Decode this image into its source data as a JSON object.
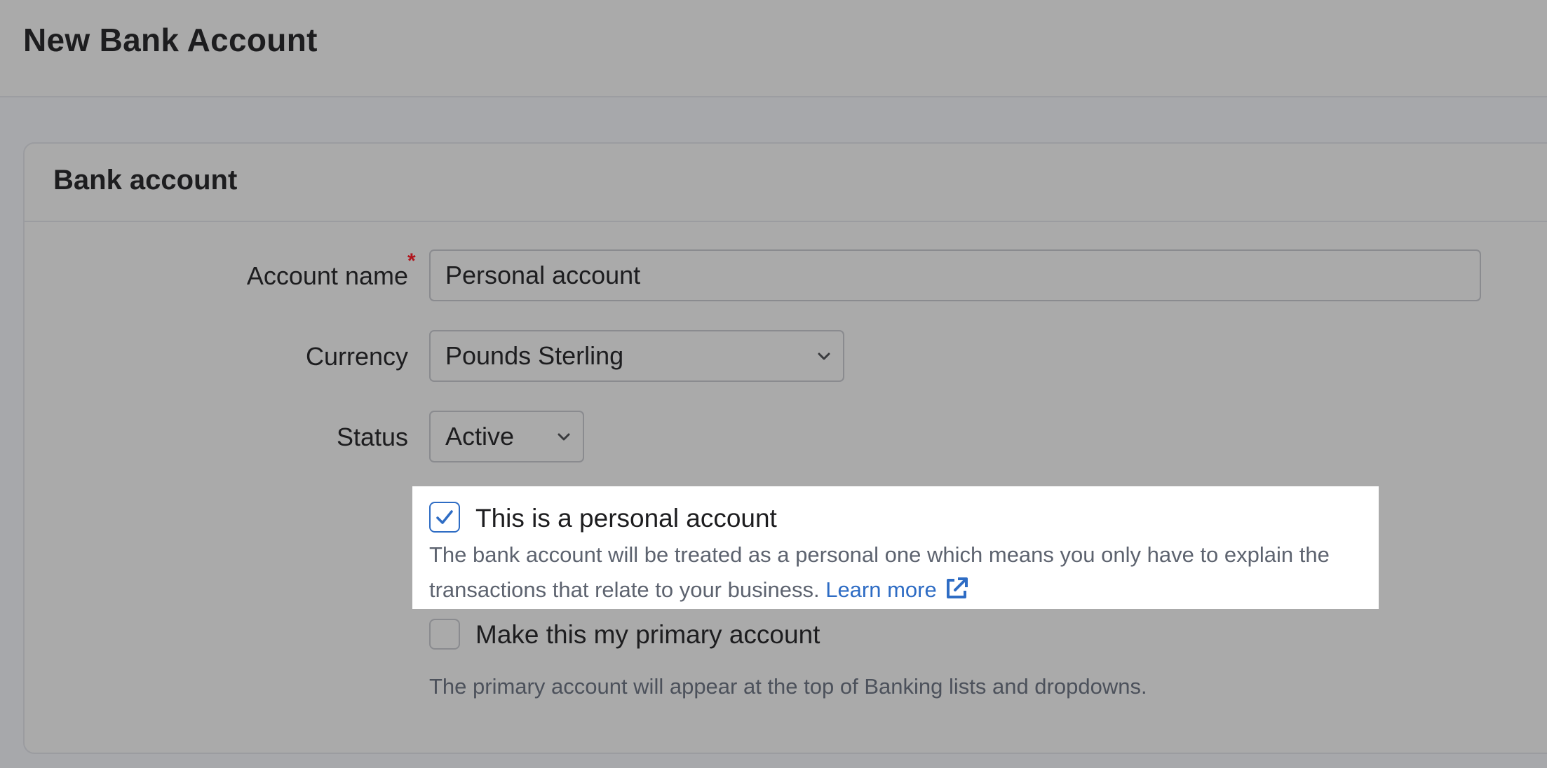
{
  "page": {
    "title": "New Bank Account"
  },
  "card": {
    "title": "Bank account"
  },
  "form": {
    "account_name": {
      "label": "Account name",
      "required_mark": "*",
      "value": "Personal account"
    },
    "currency": {
      "label": "Currency",
      "value": "Pounds Sterling"
    },
    "status": {
      "label": "Status",
      "value": "Active"
    },
    "personal": {
      "checked": true,
      "label": "This is a personal account",
      "help_text": "The bank account will be treated as a personal one which means you only have to explain the transactions that relate to your business.",
      "link_text": "Learn more"
    },
    "primary": {
      "checked": false,
      "label": "Make this my primary account",
      "help_text": "The primary account will appear at the top of Banking lists and dropdowns."
    }
  },
  "colors": {
    "accent": "#2e6cc4",
    "required": "#b0141c",
    "highlight": "#ffffff",
    "overlay": "#aaaaaa"
  },
  "icons": {
    "checkbox_checked": "check-icon",
    "select": "chevron-down-icon",
    "link": "external-link-icon"
  }
}
